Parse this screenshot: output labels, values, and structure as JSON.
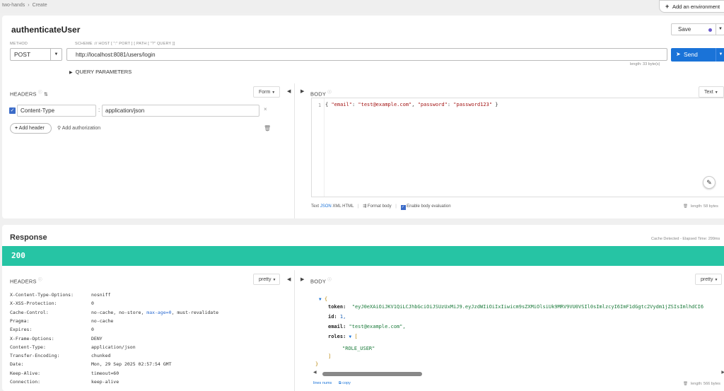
{
  "breadcrumb": {
    "root": "two-hands",
    "sep": "›",
    "current": "Create"
  },
  "env_button": {
    "icon": "plus-icon",
    "label": "Add an environment"
  },
  "request": {
    "title": "authenticateUser",
    "save_label": "Save",
    "method_label": "METHOD",
    "method": "POST",
    "url_label": "SCHEME :// HOST [ \":\" PORT ] [ PATH [ \"?\" QUERY ]]",
    "url": "http://localhost:8081/users/login",
    "send_label": "Send",
    "url_length": "length: 33 byte(s)",
    "query_params_label": "QUERY PARAMETERS",
    "headers_label": "HEADERS",
    "form_label": "Form",
    "header_rows": [
      {
        "name": "Content-Type",
        "value": "application/json"
      }
    ],
    "add_header_label": "Add header",
    "add_auth_label": "Add authorization",
    "body_label": "BODY",
    "text_label": "Text",
    "body_line_no": "1",
    "body_code": {
      "open": "{ ",
      "k1": "\"email\"",
      "sep1": ": ",
      "v1": "\"test@example.com\"",
      "sep2": ", ",
      "k2": "\"password\"",
      "sep3": ": ",
      "v2": "\"password123\"",
      "close": " }"
    },
    "body_footer": {
      "text": "Text",
      "json": "JSON",
      "xml": "XML",
      "html": "HTML",
      "format": "Format body",
      "eval": "Enable body evaluation",
      "length": "length: 58 bytes"
    }
  },
  "response": {
    "title": "Response",
    "cache_info": "Cache Detected - Elapsed Time: 299ms",
    "status": "200",
    "headers_label": "HEADERS",
    "pretty_label": "pretty",
    "body_label": "BODY",
    "headers": [
      {
        "name": "X-Content-Type-Options:",
        "value": "nosniff"
      },
      {
        "name": "X-XSS-Protection:",
        "value": "0"
      },
      {
        "name": "Cache-Control:",
        "value": "no-cache, no-store, max-age=0, must-revalidate"
      },
      {
        "name": "Pragma:",
        "value": "no-cache"
      },
      {
        "name": "Expires:",
        "value": "0"
      },
      {
        "name": "X-Frame-Options:",
        "value": "DENY"
      },
      {
        "name": "Content-Type:",
        "value": "application/json"
      },
      {
        "name": "Transfer-Encoding:",
        "value": "chunked"
      },
      {
        "name": "Date:",
        "value": "Mon, 29 Sep 2025 02:57:54 GMT"
      },
      {
        "name": "Keep-Alive:",
        "value": "timeout=60"
      },
      {
        "name": "Connection:",
        "value": "keep-alive"
      }
    ],
    "json": {
      "open": "{",
      "token_key": "token:",
      "token_val": "\"eyJ0eXAiOiJKV1QiLCJhbGciOiJSUzUxMiJ9.eyJzdWIiOiIxIiwicm9sZXMiOlsiUk9MRV9VU0VSIl0sImlzcyI6ImF1dGgtc2Vydm1jZSIsImlhdCI6",
      "id_key": "id:",
      "id_val": "1,",
      "email_key": "email:",
      "email_val": "\"test@example.com\",",
      "roles_key": "roles:",
      "roles_open": "[",
      "role1": "\"ROLE_USER\"",
      "roles_close": "]",
      "close": "}"
    },
    "footer_lines": "lines nums",
    "footer_copy": "copy",
    "length": "length: 566 bytes"
  },
  "colors": {
    "accent": "#1a73d8",
    "status": "#26c4a4"
  }
}
